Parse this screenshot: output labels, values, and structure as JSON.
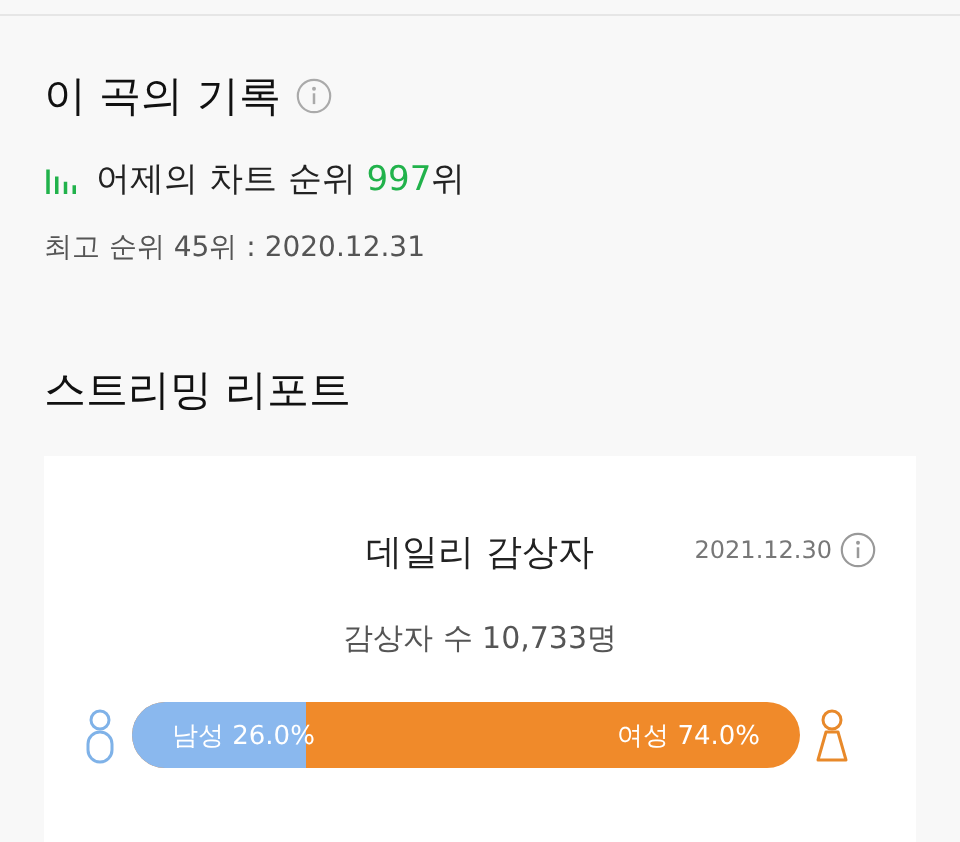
{
  "record": {
    "title": "이 곡의 기록",
    "chart_rank": {
      "prefix": "어제의 차트 순위 ",
      "rank": "997",
      "suffix": "위"
    },
    "best_rank": "최고 순위 45위 : 2020.12.31"
  },
  "streaming_report": {
    "title": "스트리밍 리포트",
    "card": {
      "title": "데일리 감상자",
      "date": "2021.12.30",
      "listener_count": "감상자 수 10,733명",
      "gender": {
        "male_label": "남성 26.0%",
        "female_label": "여성 74.0%",
        "level": 0.26
      }
    }
  }
}
